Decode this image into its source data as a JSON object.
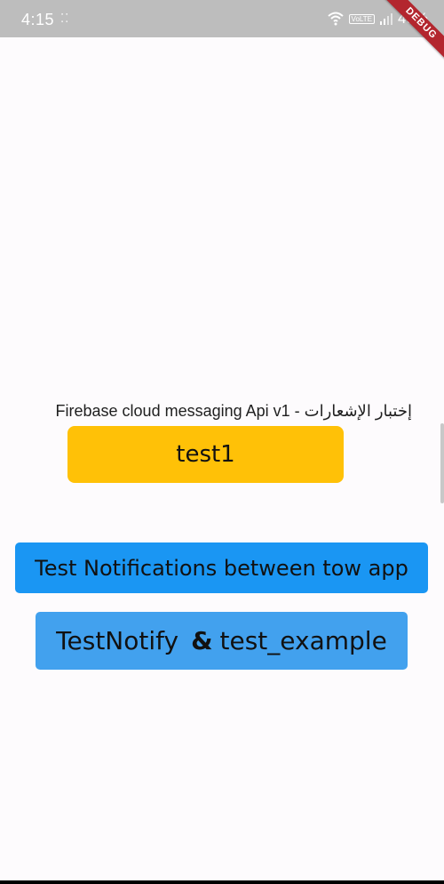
{
  "status_bar": {
    "time": "4:15",
    "notification_dots": "⁚⁚",
    "network_badge": "VoLTE",
    "battery": "49%"
  },
  "debug_banner": "DEBUG",
  "main": {
    "heading": "Firebase cloud messaging Api v1 - إختبار الإشعارات",
    "buttons": {
      "test1": "test1",
      "between_apps": "Test Notifications between tow app",
      "notify_left": "TestNotify",
      "notify_amp": "&",
      "notify_right": "test_example"
    }
  },
  "colors": {
    "status_bar": "#bdbdbd",
    "background": "#fdfbfd",
    "amber": "#ffc107",
    "blue": "#1a96f3",
    "light_blue": "#42a1ee",
    "debug": "#b3262e"
  }
}
